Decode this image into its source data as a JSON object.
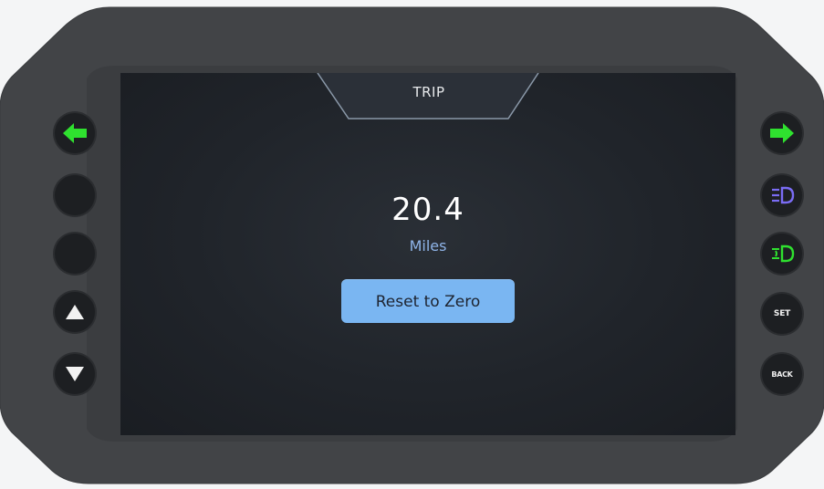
{
  "screen": {
    "title": "TRIP",
    "value": "20.4",
    "unit": "Miles",
    "reset_label": "Reset to Zero"
  },
  "buttons": {
    "set_label": "SET",
    "back_label": "BACK"
  },
  "colors": {
    "indicator_green": "#2fe12f",
    "low_beam_blue": "#7a6cf4",
    "fog_green": "#2fe12f",
    "button_blue": "#7ab6f2",
    "unit_text": "#8fb4e8"
  },
  "icons": {
    "left_turn": "left-turn-arrow-icon",
    "right_turn": "right-turn-arrow-icon",
    "high_beam": "headlight-icon",
    "fog_light": "fog-light-icon",
    "up": "triangle-up-icon",
    "down": "triangle-down-icon"
  }
}
